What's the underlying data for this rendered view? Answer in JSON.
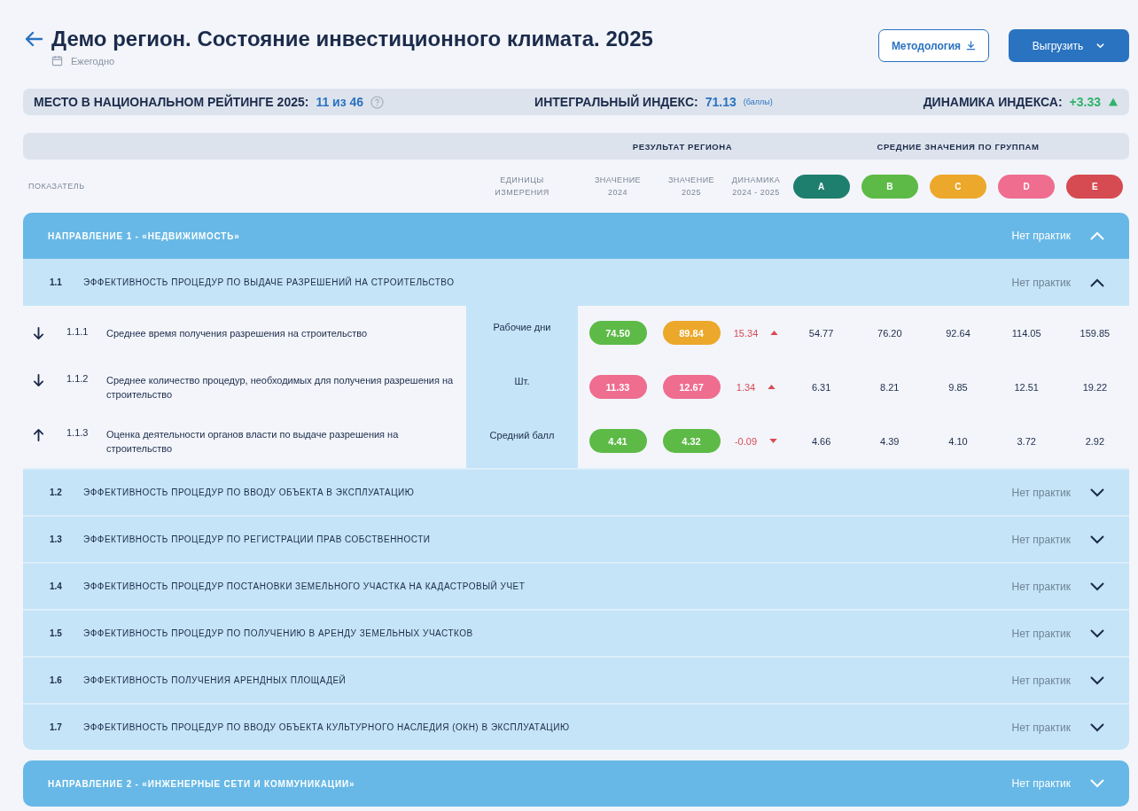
{
  "header": {
    "title": "Демо регион. Состояние инвестиционного климата. 2025",
    "period": "Ежегодно",
    "buttons": [
      {
        "label": "Методология",
        "kind": "outline"
      },
      {
        "label": "Выгрузить",
        "kind": "primary"
      }
    ]
  },
  "summary": [
    {
      "label": "МЕСТО В НАЦИОНАЛЬНОМ РЕЙТИНГЕ 2025:",
      "value": "11 из 46",
      "kind": "rank"
    },
    {
      "label": "ИНТЕГРАЛЬНЫЙ ИНДЕКС:",
      "value": "71.13",
      "unit": "(баллы)",
      "kind": "index"
    },
    {
      "label": "ДИНАМИКА ИНДЕКСА:",
      "value": "+3.33",
      "kind": "trend",
      "increased": true
    }
  ],
  "table": {
    "group_headers": [
      "РЕЗУЛЬТАТ РЕГИОНА",
      "СРЕДНИЕ ЗНАЧЕНИЯ ПО ГРУППАМ"
    ],
    "columns": [
      {
        "lines": [
          "ПОКАЗАТЕЛЬ"
        ]
      },
      {
        "lines": [
          "ЕДИНИЦЫ",
          "ИЗМЕРЕНИЯ"
        ]
      },
      {
        "lines": [
          "ЗНАЧЕНИЕ",
          "2024"
        ]
      },
      {
        "lines": [
          "ЗНАЧЕНИЕ",
          "2025"
        ]
      },
      {
        "lines": [
          "ДИНАМИКА",
          "2024 - 2025"
        ]
      }
    ],
    "groups": [
      {
        "label": "A",
        "color": "#1f7f6e"
      },
      {
        "label": "B",
        "color": "#5dba47"
      },
      {
        "label": "C",
        "color": "#eca82a"
      },
      {
        "label": "D",
        "color": "#ef6d8f"
      },
      {
        "label": "E",
        "color": "#d64b52"
      }
    ],
    "directions": [
      {
        "title": "НАПРАВЛЕНИЕ 1 - «НЕДВИЖИМОСТЬ»",
        "note": "Нет практик",
        "expanded": true,
        "sections": [
          {
            "number": "1.1",
            "title": "ЭФФЕКТИВНОСТЬ ПРОЦЕДУР ПО ВЫДАЧЕ РАЗРЕШЕНИЙ НА СТРОИТЕЛЬСТВО",
            "note": "Нет практик",
            "expanded": true,
            "indicators": [
              {
                "higher_is_better": false,
                "number": "1.1.1",
                "name": "Среднее время получения разрешения на строительство",
                "unit": "Рабочие дни",
                "value_2024": {
                  "text": "74.50",
                  "color": "#5dba47"
                },
                "value_2025": {
                  "text": "89.84",
                  "color": "#eca82a"
                },
                "change": "15.34",
                "increased": true,
                "group_values": [
                  "54.77",
                  "76.20",
                  "92.64",
                  "114.05",
                  "159.85"
                ]
              },
              {
                "higher_is_better": false,
                "number": "1.1.2",
                "name": "Среднее количество процедур, необходимых для получения разрешения на строительство",
                "unit": "Шт.",
                "value_2024": {
                  "text": "11.33",
                  "color": "#ef6d8f"
                },
                "value_2025": {
                  "text": "12.67",
                  "color": "#ef6d8f"
                },
                "change": "1.34",
                "increased": true,
                "group_values": [
                  "6.31",
                  "8.21",
                  "9.85",
                  "12.51",
                  "19.22"
                ]
              },
              {
                "higher_is_better": true,
                "number": "1.1.3",
                "name": "Оценка деятельности органов власти по выдаче разрешения на строительство",
                "unit": "Средний балл",
                "value_2024": {
                  "text": "4.41",
                  "color": "#5dba47"
                },
                "value_2025": {
                  "text": "4.32",
                  "color": "#5dba47"
                },
                "change": "-0.09",
                "increased": false,
                "group_values": [
                  "4.66",
                  "4.39",
                  "4.10",
                  "3.72",
                  "2.92"
                ]
              }
            ]
          },
          {
            "number": "1.2",
            "title": "ЭФФЕКТИВНОСТЬ ПРОЦЕДУР ПО ВВОДУ ОБЪЕКТА В ЭКСПЛУАТАЦИЮ",
            "note": "Нет практик",
            "expanded": false
          },
          {
            "number": "1.3",
            "title": "ЭФФЕКТИВНОСТЬ ПРОЦЕДУР ПО РЕГИСТРАЦИИ ПРАВ СОБСТВЕННОСТИ",
            "note": "Нет практик",
            "expanded": false
          },
          {
            "number": "1.4",
            "title": "ЭФФЕКТИВНОСТЬ ПРОЦЕДУР ПОСТАНОВКИ ЗЕМЕЛЬНОГО УЧАСТКА НА КАДАСТРОВЫЙ УЧЕТ",
            "note": "Нет практик",
            "expanded": false
          },
          {
            "number": "1.5",
            "title": "ЭФФЕКТИВНОСТЬ ПРОЦЕДУР ПО ПОЛУЧЕНИЮ В АРЕНДУ ЗЕМЕЛЬНЫХ УЧАСТКОВ",
            "note": "Нет практик",
            "expanded": false
          },
          {
            "number": "1.6",
            "title": "ЭФФЕКТИВНОСТЬ ПОЛУЧЕНИЯ АРЕНДНЫХ ПЛОЩАДЕЙ",
            "note": "Нет практик",
            "expanded": false
          },
          {
            "number": "1.7",
            "title": "ЭФФЕКТИВНОСТЬ ПРОЦЕДУР ПО ВВОДУ ОБЪЕКТА КУЛЬТУРНОГО НАСЛЕДИЯ (ОКН) В ЭКСПЛУАТАЦИЮ",
            "note": "Нет практик",
            "expanded": false
          }
        ]
      },
      {
        "title": "НАПРАВЛЕНИЕ 2 - «ИНЖЕНЕРНЫЕ СЕТИ И КОММУНИКАЦИИ»",
        "note": "Нет практик",
        "expanded": false
      }
    ]
  }
}
